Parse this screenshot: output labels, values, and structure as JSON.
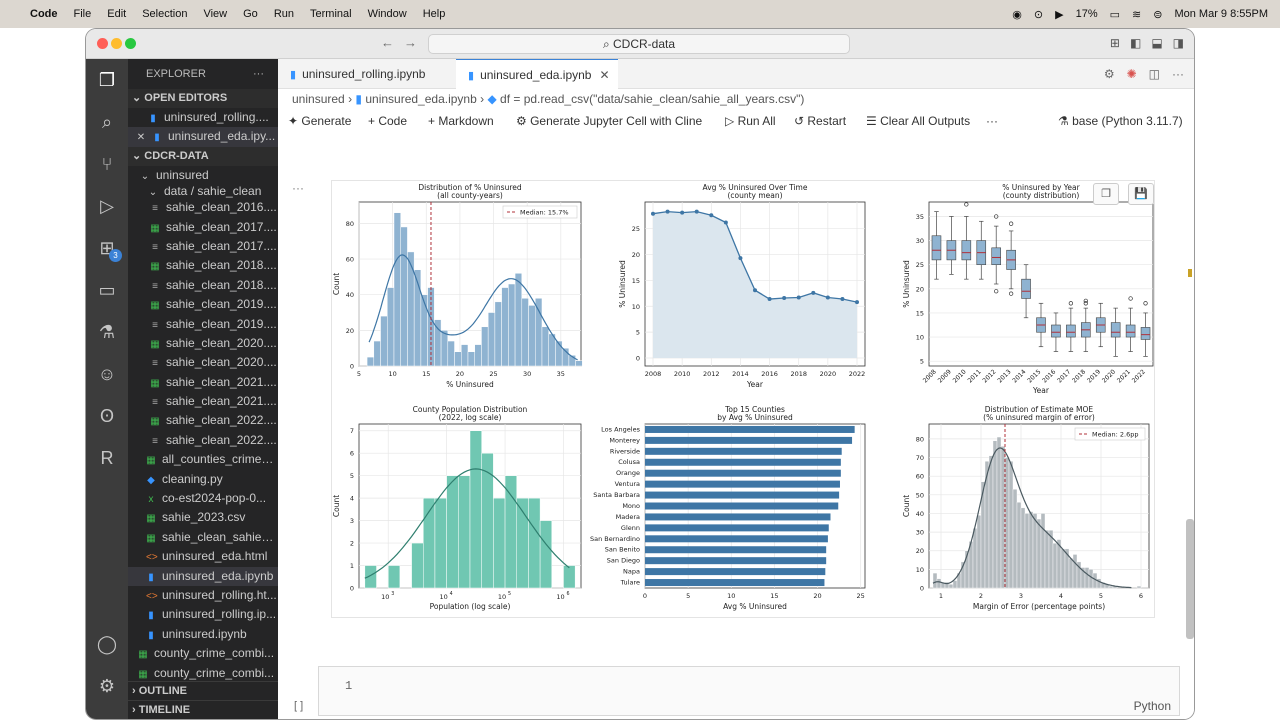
{
  "menubar": {
    "app": "Code",
    "items": [
      "File",
      "Edit",
      "Selection",
      "View",
      "Go",
      "Run",
      "Terminal",
      "Window",
      "Help"
    ],
    "battery": "17%",
    "datetime": "Mon Mar 9  8:55PM"
  },
  "window": {
    "search": "CDCR-data"
  },
  "tabs": [
    {
      "label": "uninsured_rolling.ipynb"
    },
    {
      "label": "uninsured_eda.ipynb"
    }
  ],
  "breadcrumb": {
    "folder": "uninsured",
    "file": "uninsured_eda.ipynb",
    "cell": "df = pd.read_csv(\"data/sahie_clean/sahie_all_years.csv\")"
  },
  "toolbar": {
    "generate": "Generate",
    "code": "Code",
    "markdown": "Markdown",
    "cline": "Generate Jupyter Cell with Cline",
    "run_all": "Run All",
    "restart": "Restart",
    "clear": "Clear All Outputs",
    "more": "···",
    "kernel": "base (Python 3.11.7)"
  },
  "sidebar": {
    "explorer": "EXPLORER",
    "open_editors": "OPEN EDITORS",
    "open_files": [
      "uninsured_rolling....",
      "uninsured_eda.ipy..."
    ],
    "root": "CDCR-DATA",
    "folder": "uninsured",
    "subfolder": "data / sahie_clean",
    "files": [
      {
        "name": "sahie_clean_2016....",
        "icon": "lines"
      },
      {
        "name": "sahie_clean_2017....",
        "icon": "csv"
      },
      {
        "name": "sahie_clean_2017....",
        "icon": "lines"
      },
      {
        "name": "sahie_clean_2018....",
        "icon": "csv"
      },
      {
        "name": "sahie_clean_2018....",
        "icon": "lines"
      },
      {
        "name": "sahie_clean_2019....",
        "icon": "csv"
      },
      {
        "name": "sahie_clean_2019....",
        "icon": "lines"
      },
      {
        "name": "sahie_clean_2020....",
        "icon": "csv"
      },
      {
        "name": "sahie_clean_2020....",
        "icon": "lines"
      },
      {
        "name": "sahie_clean_2021....",
        "icon": "csv"
      },
      {
        "name": "sahie_clean_2021....",
        "icon": "lines"
      },
      {
        "name": "sahie_clean_2022....",
        "icon": "csv"
      },
      {
        "name": "sahie_clean_2022....",
        "icon": "lines"
      }
    ],
    "folder_files": [
      {
        "name": "all_counties_crime_...",
        "icon": "csv"
      },
      {
        "name": "cleaning.py",
        "icon": "py"
      },
      {
        "name": "co-est2024-pop-0...",
        "icon": "xl"
      },
      {
        "name": "sahie_2023.csv",
        "icon": "csv"
      },
      {
        "name": "sahie_clean_sahie_...",
        "icon": "csv"
      },
      {
        "name": "uninsured_eda.html",
        "icon": "html"
      },
      {
        "name": "uninsured_eda.ipynb",
        "icon": "ipy"
      },
      {
        "name": "uninsured_rolling.ht...",
        "icon": "html"
      },
      {
        "name": "uninsured_rolling.ip...",
        "icon": "ipy"
      },
      {
        "name": "uninsured.ipynb",
        "icon": "ipy"
      }
    ],
    "root_files": [
      {
        "name": "county_crime_combi...",
        "icon": "csv"
      },
      {
        "name": "county_crime_combi...",
        "icon": "csv"
      }
    ],
    "outline": "OUTLINE",
    "timeline": "TIMELINE"
  },
  "input_cell": {
    "line": "1",
    "lang": "Python",
    "exec": "[ ]"
  },
  "colors": {
    "hist_blue": "#8fb3d1",
    "line_blue": "#3e76a5",
    "teal": "#70c7b2",
    "gray": "#b4bbbf",
    "median": "#b0303a"
  },
  "chart_data": [
    {
      "type": "bar",
      "title": "Distribution of % Uninsured",
      "subtitle": "(all county-years)",
      "xlabel": "% Uninsured",
      "ylabel": "Count",
      "xticks": [
        5,
        10,
        15,
        20,
        25,
        30,
        35
      ],
      "yticks": [
        0,
        20,
        40,
        60,
        80
      ],
      "xlim": [
        5,
        38
      ],
      "ylim": [
        0,
        92
      ],
      "legend": "Median: 15.7%",
      "median": 15.7,
      "bins": [
        6.2,
        7.2,
        8.2,
        9.2,
        10.2,
        11.2,
        12.2,
        13.2,
        14.2,
        15.2,
        16.2,
        17.2,
        18.2,
        19.2,
        20.2,
        21.2,
        22.2,
        23.2,
        24.2,
        25.2,
        26.2,
        27.2,
        28.2,
        29.2,
        30.2,
        31.2,
        32.2,
        33.2,
        34.2,
        35.2,
        36.2,
        37.2
      ],
      "values": [
        5,
        14,
        28,
        44,
        86,
        78,
        64,
        54,
        40,
        44,
        26,
        20,
        14,
        8,
        12,
        8,
        12,
        22,
        30,
        36,
        44,
        46,
        52,
        38,
        34,
        38,
        22,
        18,
        14,
        10,
        6,
        3
      ]
    },
    {
      "type": "line",
      "title": "Avg % Uninsured Over Time",
      "subtitle": "(county mean)",
      "xlabel": "Year",
      "ylabel": "% Uninsured",
      "x": [
        2008,
        2009,
        2010,
        2011,
        2012,
        2013,
        2014,
        2015,
        2016,
        2017,
        2018,
        2019,
        2020,
        2021,
        2022
      ],
      "values": [
        27.9,
        28.3,
        28.1,
        28.3,
        27.6,
        26.2,
        19.3,
        13.1,
        11.4,
        11.6,
        11.7,
        12.6,
        11.7,
        11.4,
        10.8
      ],
      "xticks": [
        2008,
        2010,
        2012,
        2014,
        2016,
        2018,
        2020,
        2022
      ],
      "yticks": [
        0,
        5,
        10,
        15,
        20,
        25
      ],
      "ylim": [
        0,
        29
      ]
    },
    {
      "type": "box",
      "title": "% Uninsured by Year",
      "subtitle": "(county distribution)",
      "xlabel": "Year",
      "ylabel": "% Uninsured",
      "categories": [
        "2008",
        "2009",
        "2010",
        "2011",
        "2012",
        "2013",
        "2014",
        "2015",
        "2016",
        "2017",
        "2018",
        "2019",
        "2020",
        "2021",
        "2022"
      ],
      "boxes": [
        [
          22,
          26,
          28,
          31,
          36
        ],
        [
          23,
          26,
          28,
          30,
          35
        ],
        [
          22,
          26,
          27.5,
          30,
          35
        ],
        [
          22,
          25,
          27.5,
          30,
          34
        ],
        [
          21,
          25,
          26.5,
          28.5,
          33
        ],
        [
          20,
          24,
          26,
          28,
          32
        ],
        [
          14,
          18,
          19.5,
          22,
          25
        ],
        [
          8,
          11,
          12.5,
          14,
          17
        ],
        [
          7,
          10,
          11,
          12.5,
          15
        ],
        [
          7,
          10,
          11,
          12.5,
          16
        ],
        [
          7,
          10,
          11.5,
          13,
          16
        ],
        [
          8,
          11,
          12.5,
          14,
          17
        ],
        [
          6,
          10,
          11,
          13,
          16
        ],
        [
          7,
          10,
          11,
          12.5,
          16
        ],
        [
          6,
          9.5,
          10.5,
          12,
          15
        ]
      ],
      "yticks": [
        5,
        10,
        15,
        20,
        25,
        30,
        35
      ],
      "ylim": [
        4,
        38
      ]
    },
    {
      "type": "bar",
      "title": "County Population Distribution",
      "subtitle": "(2022, log scale)",
      "xlabel": "Population (log scale)",
      "ylabel": "Count",
      "xticks": [
        "10^3",
        "10^4",
        "10^5",
        "10^6"
      ],
      "yticks": [
        0,
        1,
        2,
        3,
        4,
        5,
        6,
        7
      ],
      "ylim": [
        0,
        7.3
      ],
      "bins": [
        2.6,
        2.8,
        3.0,
        3.2,
        3.4,
        3.6,
        3.8,
        4.0,
        4.2,
        4.4,
        4.6,
        4.8,
        5.0,
        5.2,
        5.4,
        5.6,
        5.8,
        6.0
      ],
      "values": [
        1,
        0,
        1,
        0,
        2,
        4,
        4,
        5,
        5,
        7,
        6,
        4,
        5,
        4,
        4,
        3,
        0,
        1
      ]
    },
    {
      "type": "bar",
      "orientation": "horizontal",
      "title": "Top 15 Counties",
      "subtitle": "by Avg % Uninsured",
      "xlabel": "Avg % Uninsured",
      "categories": [
        "Los Angeles",
        "Monterey",
        "Riverside",
        "Colusa",
        "Orange",
        "Ventura",
        "Santa Barbara",
        "Mono",
        "Madera",
        "Glenn",
        "San Bernardino",
        "San Benito",
        "San Diego",
        "Napa",
        "Tulare"
      ],
      "values": [
        24.3,
        24.0,
        22.8,
        22.7,
        22.7,
        22.6,
        22.5,
        22.4,
        21.5,
        21.3,
        21.2,
        21.0,
        21.0,
        20.9,
        20.8
      ],
      "xticks": [
        0,
        5,
        10,
        15,
        20,
        25
      ],
      "xlim": [
        0,
        25.5
      ]
    },
    {
      "type": "bar",
      "title": "Distribution of Estimate MOE",
      "subtitle": "(% uninsured margin of error)",
      "xlabel": "Margin of Error (percentage points)",
      "ylabel": "Count",
      "xticks": [
        1,
        2,
        3,
        4,
        5,
        6
      ],
      "yticks": [
        0,
        10,
        20,
        30,
        40,
        50,
        60,
        70,
        80
      ],
      "xlim": [
        0.7,
        6.2
      ],
      "ylim": [
        0,
        88
      ],
      "legend": "Median: 2.6pp",
      "median": 2.6,
      "bins": [
        0.8,
        0.9,
        1.0,
        1.1,
        1.2,
        1.3,
        1.4,
        1.5,
        1.6,
        1.7,
        1.8,
        1.9,
        2.0,
        2.1,
        2.2,
        2.3,
        2.4,
        2.5,
        2.6,
        2.7,
        2.8,
        2.9,
        3.0,
        3.1,
        3.2,
        3.3,
        3.4,
        3.5,
        3.6,
        3.7,
        3.8,
        3.9,
        4.0,
        4.1,
        4.2,
        4.3,
        4.4,
        4.5,
        4.6,
        4.7,
        4.8,
        4.9,
        5.0,
        5.1,
        5.2,
        5.3,
        5.4,
        5.5,
        5.6,
        5.7,
        5.8,
        5.9
      ],
      "values": [
        8,
        5,
        3,
        3,
        2,
        4,
        8,
        14,
        20,
        25,
        32,
        39,
        57,
        68,
        71,
        79,
        81,
        76,
        70,
        68,
        53,
        46,
        43,
        40,
        41,
        40,
        37,
        40,
        31,
        31,
        24,
        26,
        21,
        21,
        16,
        18,
        14,
        11,
        11,
        10,
        8,
        5,
        3,
        2,
        1,
        1,
        0,
        0,
        0,
        0,
        0,
        1
      ]
    }
  ]
}
